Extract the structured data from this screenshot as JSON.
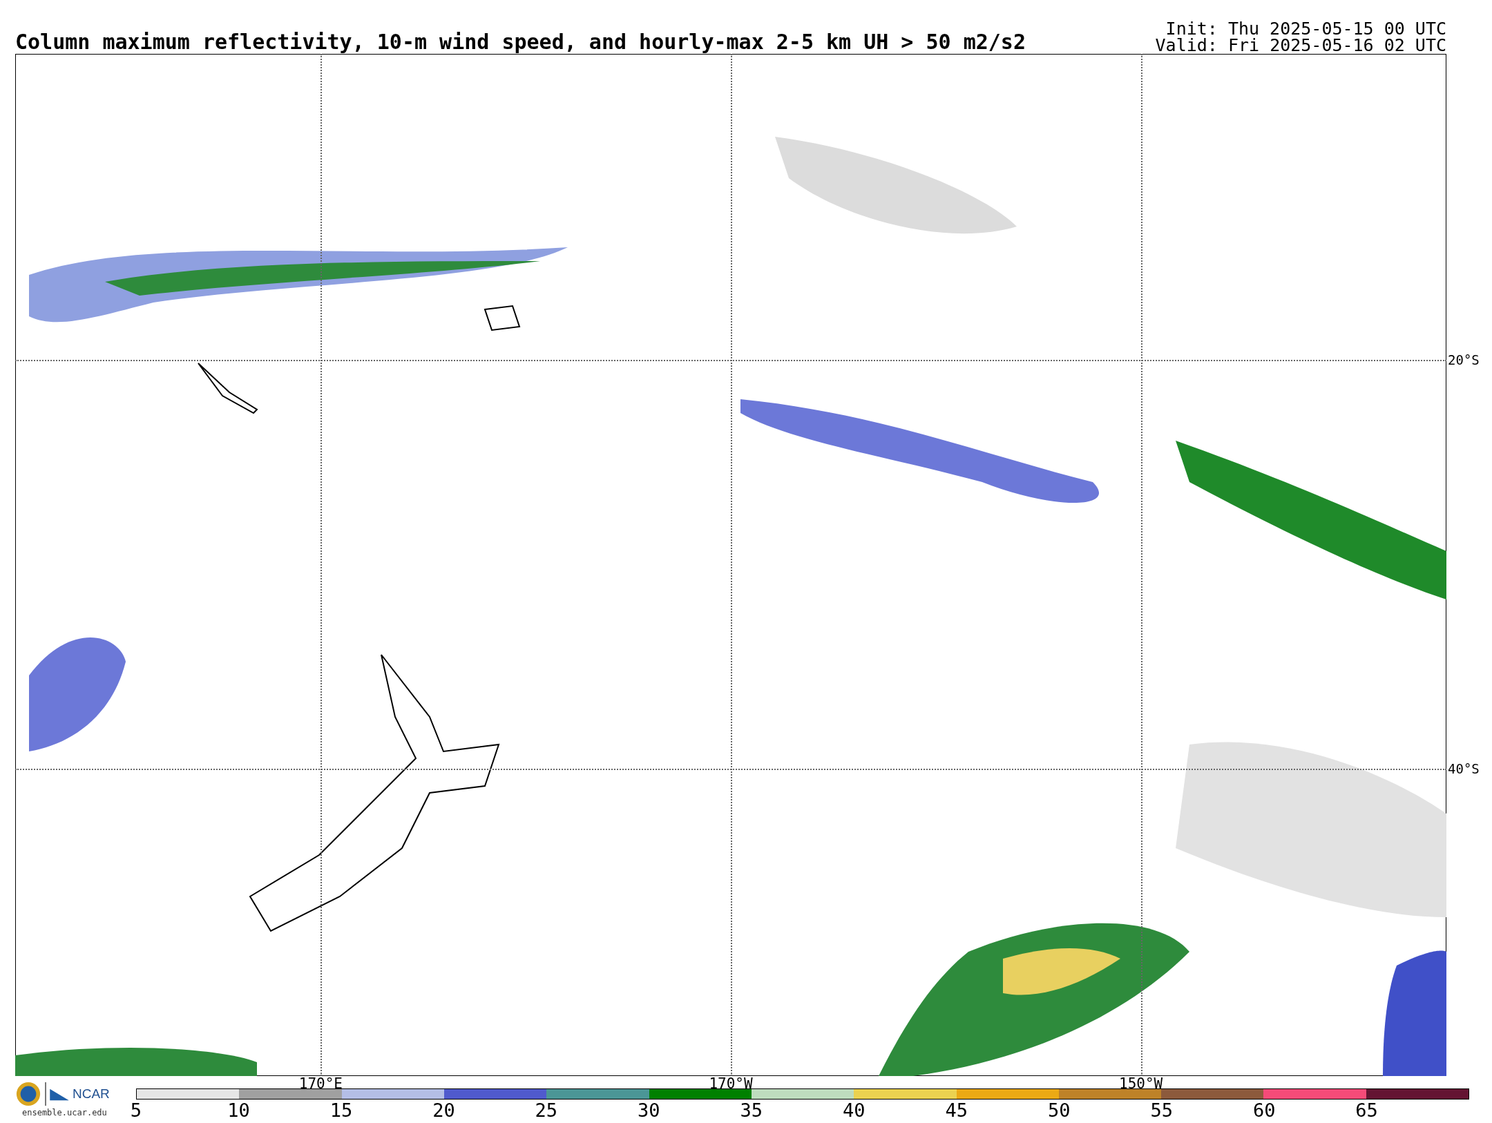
{
  "title": "Column maximum reflectivity, 10-m wind speed, and hourly-max 2-5 km UH > 50 m2/s2",
  "init": "Init: Thu 2025-05-15 00 UTC",
  "valid": "Valid: Fri 2025-05-16 02 UTC",
  "map": {
    "lat_labels": [
      {
        "label": "20°S"
      },
      {
        "label": "40°S"
      }
    ],
    "lon_labels": [
      {
        "label": "170°E"
      },
      {
        "label": "170°W"
      },
      {
        "label": "150°W"
      }
    ]
  },
  "logos": {
    "ncar": "NCAR",
    "site": "ensemble.ucar.edu"
  },
  "colorbar": {
    "bins": [
      {
        "tick": "5",
        "color": "#e6e6e6"
      },
      {
        "tick": "10",
        "color": "#a0a0a0"
      },
      {
        "tick": "15",
        "color": "#b4bee6"
      },
      {
        "tick": "20",
        "color": "#505acd"
      },
      {
        "tick": "25",
        "color": "#4b9696"
      },
      {
        "tick": "30",
        "color": "#008000"
      },
      {
        "tick": "35",
        "color": "#bedcbe"
      },
      {
        "tick": "40",
        "color": "#ebd250"
      },
      {
        "tick": "45",
        "color": "#eba914"
      },
      {
        "tick": "50",
        "color": "#be8228"
      },
      {
        "tick": "55",
        "color": "#8c5a3c"
      },
      {
        "tick": "60",
        "color": "#f54b78"
      },
      {
        "tick": "65",
        "color": "#641432"
      }
    ]
  }
}
